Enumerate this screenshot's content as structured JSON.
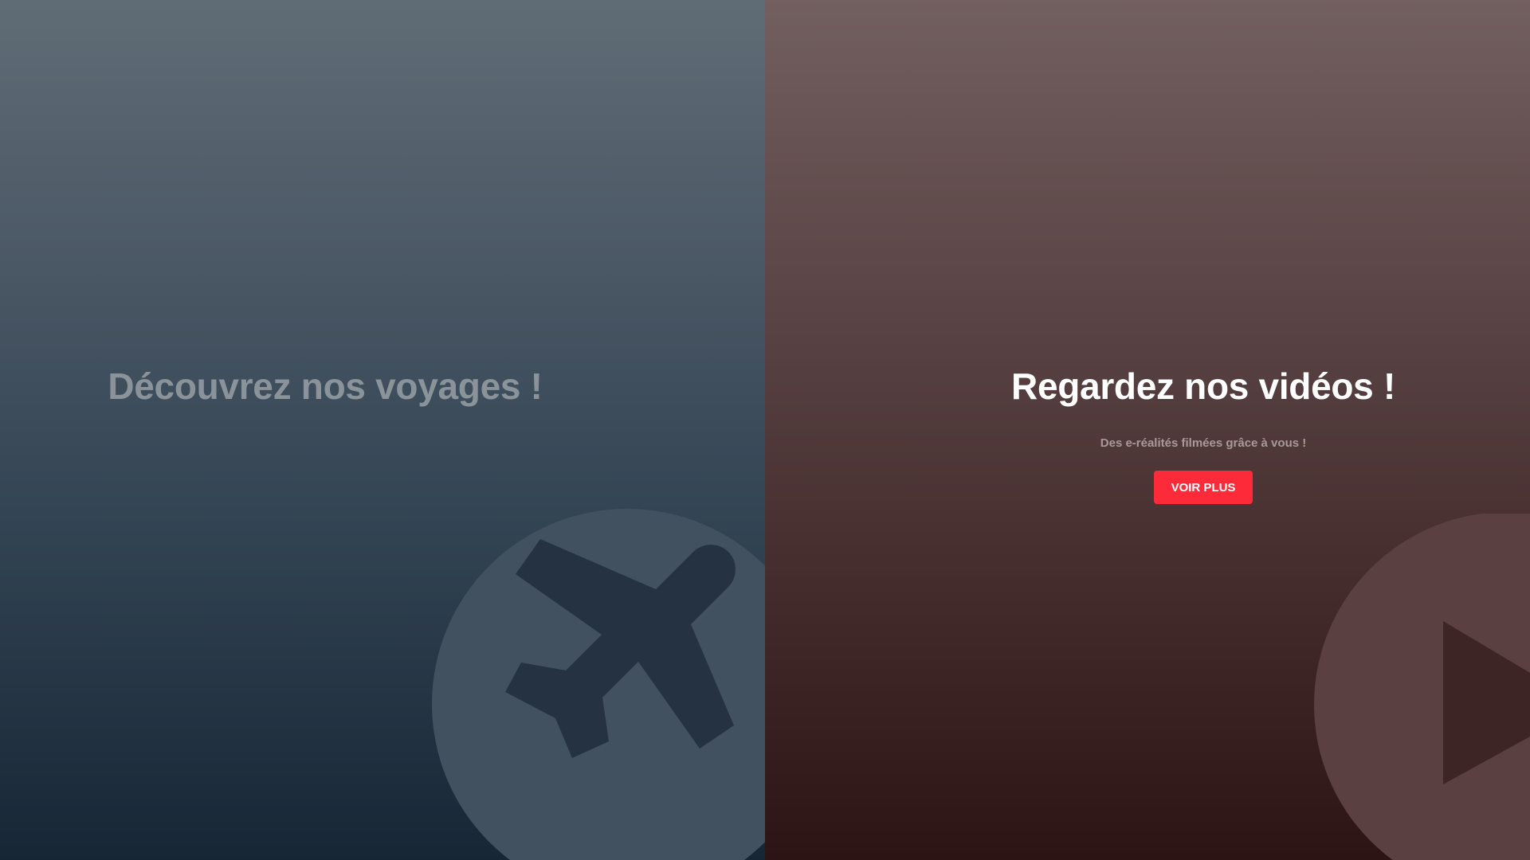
{
  "left_panel": {
    "title": "Découvrez nos voyages !",
    "icon": "airplane-icon",
    "title_color": "#8a939a"
  },
  "right_panel": {
    "title": "Regardez nos vidéos !",
    "subtitle": "Des e-réalités filmées grâce à vous !",
    "button_label": "VOIR PLUS",
    "icon": "play-icon",
    "accent_color": "#fd2b39"
  }
}
